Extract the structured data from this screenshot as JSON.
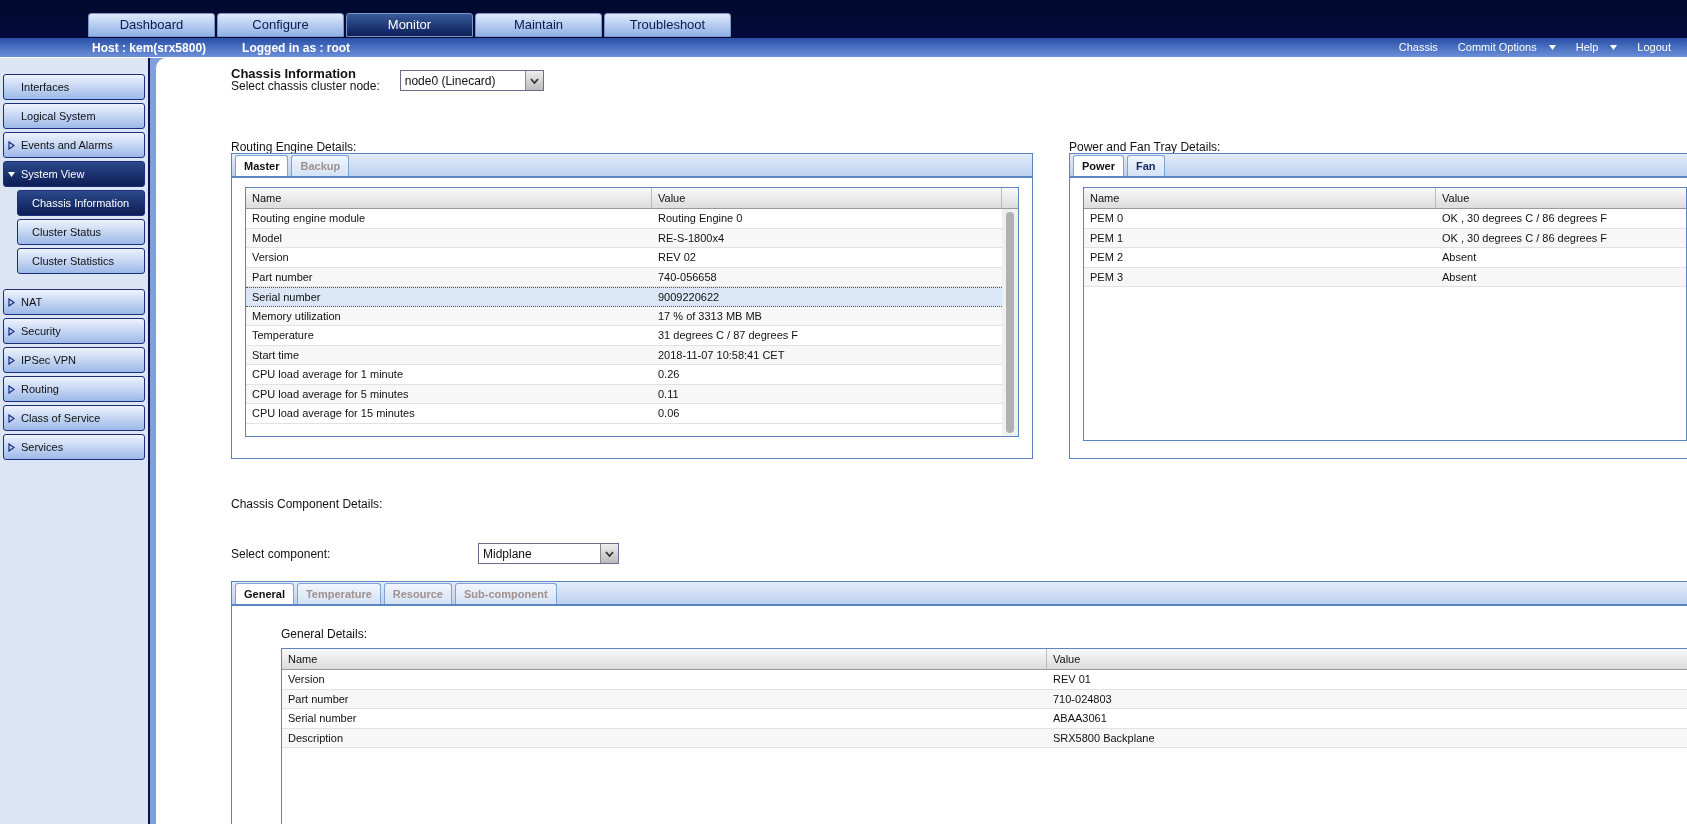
{
  "top_nav": {
    "tabs": [
      {
        "label": "Dashboard",
        "selected": false
      },
      {
        "label": "Configure",
        "selected": false
      },
      {
        "label": "Monitor",
        "selected": true
      },
      {
        "label": "Maintain",
        "selected": false
      },
      {
        "label": "Troubleshoot",
        "selected": false
      }
    ],
    "host": "Host : kem(srx5800)",
    "logged_in": "Logged in as : root",
    "links": [
      {
        "label": "Chassis",
        "dropdown": false
      },
      {
        "label": "Commit Options",
        "dropdown": true
      },
      {
        "label": "Help",
        "dropdown": true
      },
      {
        "label": "Logout",
        "dropdown": false
      }
    ]
  },
  "sidebar": {
    "items": [
      {
        "label": "Interfaces",
        "kind": "leaf"
      },
      {
        "label": "Logical System",
        "kind": "leaf"
      },
      {
        "label": "Events and Alarms",
        "kind": "group",
        "expanded": false
      },
      {
        "label": "System View",
        "kind": "group",
        "expanded": true,
        "children": [
          {
            "label": "Chassis Information",
            "selected": true
          },
          {
            "label": "Cluster Status",
            "selected": false
          },
          {
            "label": "Cluster Statistics",
            "selected": false
          }
        ]
      },
      {
        "label": "NAT",
        "kind": "group",
        "expanded": false
      },
      {
        "label": "Security",
        "kind": "group",
        "expanded": false
      },
      {
        "label": "IPSec VPN",
        "kind": "group",
        "expanded": false
      },
      {
        "label": "Routing",
        "kind": "group",
        "expanded": false
      },
      {
        "label": "Class of Service",
        "kind": "group",
        "expanded": false
      },
      {
        "label": "Services",
        "kind": "group",
        "expanded": false
      }
    ]
  },
  "page": {
    "title": "Chassis Information",
    "node_select": {
      "label": "Select chassis cluster node:",
      "value": "node0 (Linecard)"
    }
  },
  "routing_engine": {
    "title": "Routing Engine Details:",
    "tabs": [
      {
        "label": "Master",
        "selected": true,
        "disabled": false
      },
      {
        "label": "Backup",
        "selected": false,
        "disabled": true
      }
    ],
    "columns": [
      "Name",
      "Value"
    ],
    "rows": [
      {
        "name": "Routing engine module",
        "value": "Routing Engine 0",
        "selected": false
      },
      {
        "name": "Model",
        "value": "RE-S-1800x4",
        "selected": false
      },
      {
        "name": "Version",
        "value": "REV 02",
        "selected": false
      },
      {
        "name": "Part number",
        "value": "740-056658",
        "selected": false
      },
      {
        "name": "Serial number",
        "value": "9009220622",
        "selected": true
      },
      {
        "name": "Memory utilization",
        "value": "17 % of 3313 MB MB",
        "selected": false
      },
      {
        "name": "Temperature",
        "value": "31 degrees C / 87 degrees F",
        "selected": false
      },
      {
        "name": "Start time",
        "value": "2018-11-07 10:58:41 CET",
        "selected": false
      },
      {
        "name": "CPU load average for 1 minute",
        "value": "0.26",
        "selected": false
      },
      {
        "name": "CPU load average for 5 minutes",
        "value": "0.11",
        "selected": false
      },
      {
        "name": "CPU load average for 15 minutes",
        "value": "0.06",
        "selected": false
      }
    ]
  },
  "power_fan": {
    "title": "Power and Fan Tray Details:",
    "tabs": [
      {
        "label": "Power",
        "selected": true,
        "disabled": false
      },
      {
        "label": "Fan",
        "selected": false,
        "disabled": false
      }
    ],
    "columns": [
      "Name",
      "Value"
    ],
    "rows": [
      {
        "name": "PEM 0",
        "value": "OK , 30 degrees C / 86 degrees F",
        "selected": false
      },
      {
        "name": "PEM 1",
        "value": "OK , 30 degrees C / 86 degrees F",
        "selected": false
      },
      {
        "name": "PEM 2",
        "value": "Absent",
        "selected": false
      },
      {
        "name": "PEM 3",
        "value": "Absent",
        "selected": false
      }
    ]
  },
  "component": {
    "title": "Chassis Component Details:",
    "select": {
      "label": "Select component:",
      "value": "Midplane"
    },
    "tabs": [
      {
        "label": "General",
        "selected": true,
        "disabled": false
      },
      {
        "label": "Temperature",
        "selected": false,
        "disabled": true
      },
      {
        "label": "Resource",
        "selected": false,
        "disabled": true
      },
      {
        "label": "Sub-component",
        "selected": false,
        "disabled": true
      }
    ],
    "details_title": "General Details:",
    "columns": [
      "Name",
      "Value"
    ],
    "rows": [
      {
        "name": "Version",
        "value": "REV 01",
        "selected": false
      },
      {
        "name": "Part number",
        "value": "710-024803",
        "selected": false
      },
      {
        "name": "Serial number",
        "value": "ABAA3061",
        "selected": false
      },
      {
        "name": "Description",
        "value": "SRX5800 Backplane",
        "selected": false
      }
    ]
  }
}
